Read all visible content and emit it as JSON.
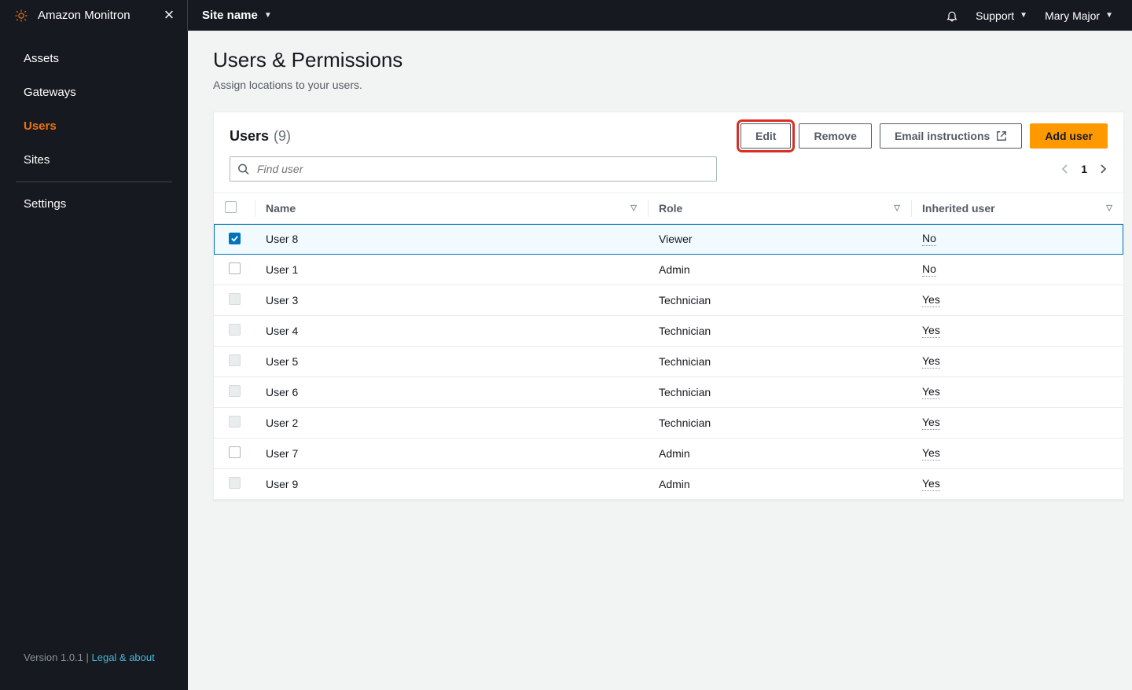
{
  "brand": {
    "name": "Amazon Monitron"
  },
  "topbar": {
    "site_label": "Site name",
    "support_label": "Support",
    "user_label": "Mary Major"
  },
  "sidebar": {
    "items": [
      {
        "label": "Assets",
        "active": false
      },
      {
        "label": "Gateways",
        "active": false
      },
      {
        "label": "Users",
        "active": true
      },
      {
        "label": "Sites",
        "active": false
      }
    ],
    "settings_label": "Settings",
    "footer_version": "Version 1.0.1",
    "footer_sep": " | ",
    "footer_legal": "Legal & about"
  },
  "page": {
    "title": "Users & Permissions",
    "subtitle": "Assign locations to your users."
  },
  "panel": {
    "title": "Users",
    "count": "(9)",
    "actions": {
      "edit": "Edit",
      "remove": "Remove",
      "email": "Email instructions",
      "add": "Add user"
    },
    "search_placeholder": "Find user",
    "page_number": "1",
    "columns": {
      "name": "Name",
      "role": "Role",
      "inherited": "Inherited user"
    },
    "rows": [
      {
        "selected": true,
        "cb_state": "checked",
        "name": "User 8",
        "role": "Viewer",
        "inherited": "No"
      },
      {
        "selected": false,
        "cb_state": "empty",
        "name": "User 1",
        "role": "Admin",
        "inherited": "No"
      },
      {
        "selected": false,
        "cb_state": "dim",
        "name": "User 3",
        "role": "Technician",
        "inherited": "Yes"
      },
      {
        "selected": false,
        "cb_state": "dim",
        "name": "User 4",
        "role": "Technician",
        "inherited": "Yes"
      },
      {
        "selected": false,
        "cb_state": "dim",
        "name": "User 5",
        "role": "Technician",
        "inherited": "Yes"
      },
      {
        "selected": false,
        "cb_state": "dim",
        "name": "User 6",
        "role": "Technician",
        "inherited": "Yes"
      },
      {
        "selected": false,
        "cb_state": "dim",
        "name": "User 2",
        "role": "Technician",
        "inherited": "Yes"
      },
      {
        "selected": false,
        "cb_state": "empty",
        "name": "User 7",
        "role": "Admin",
        "inherited": "Yes"
      },
      {
        "selected": false,
        "cb_state": "dim",
        "name": "User 9",
        "role": "Admin",
        "inherited": "Yes"
      }
    ]
  }
}
